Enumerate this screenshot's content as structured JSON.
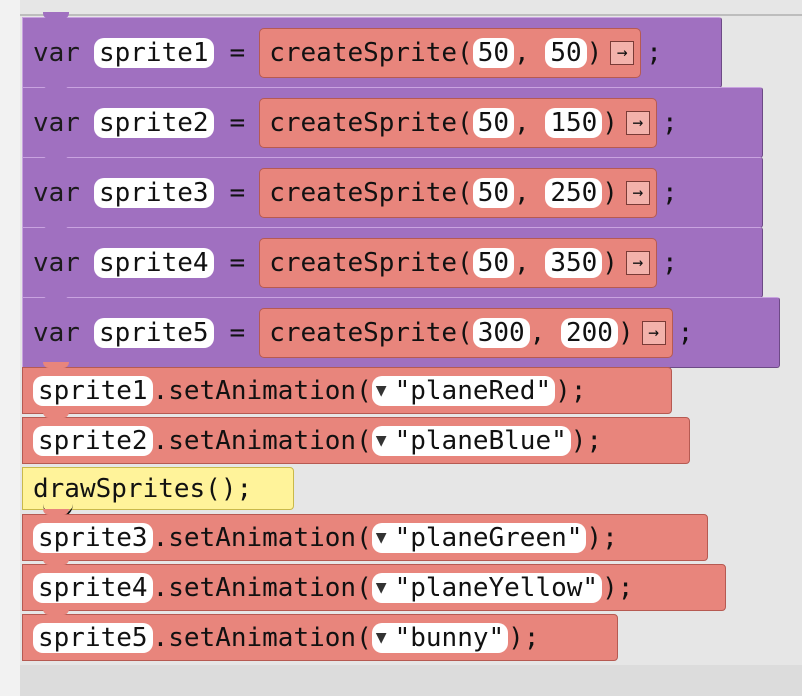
{
  "keyword_var": "var",
  "equals": "=",
  "func_create": "createSprite",
  "arrow": "→",
  "semicolon": ";",
  "var_blocks": [
    {
      "name": "sprite1",
      "x": "50",
      "y": "50"
    },
    {
      "name": "sprite2",
      "x": "50",
      "y": "150"
    },
    {
      "name": "sprite3",
      "x": "50",
      "y": "250"
    },
    {
      "name": "sprite4",
      "x": "50",
      "y": "350"
    },
    {
      "name": "sprite5",
      "x": "300",
      "y": "200"
    }
  ],
  "method_set": ".setAnimation(",
  "set_blocks": [
    {
      "sprite": "sprite1",
      "anim": "\"planeRed\""
    },
    {
      "sprite": "sprite2",
      "anim": "\"planeBlue\""
    },
    {
      "sprite": "sprite3",
      "anim": "\"planeGreen\""
    },
    {
      "sprite": "sprite4",
      "anim": "\"planeYellow\""
    },
    {
      "sprite": "sprite5",
      "anim": "\"bunny\""
    }
  ],
  "close_call": ");",
  "draw_call": "drawSprites();",
  "dropdown_caret": "▼",
  "comma": ",",
  "open_paren": "(",
  "close_paren": ")"
}
